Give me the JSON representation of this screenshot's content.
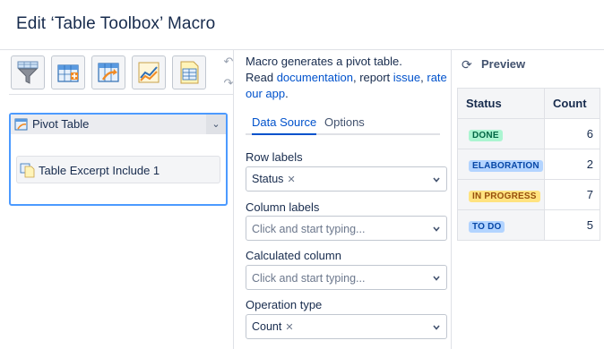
{
  "header": {
    "title": "Edit ‘Table Toolbox’ Macro"
  },
  "toolbar": {
    "buttons": [
      {
        "icon": "funnel-icon"
      },
      {
        "icon": "add-table-icon"
      },
      {
        "icon": "transform-table-icon"
      },
      {
        "icon": "chart-icon"
      },
      {
        "icon": "table-excerpt-icon"
      }
    ],
    "undo_icon": "↶",
    "redo_icon": "↷"
  },
  "tree": {
    "root_label": "Pivot Table",
    "child_label": "Table Excerpt Include 1",
    "chevron": "⌄"
  },
  "description": {
    "line1": "Macro generates a pivot table.",
    "read": "Read ",
    "doc_link": "documentation",
    "report": ", report ",
    "issue_link": "issue",
    "comma": ", ",
    "rate_link": "rate our app",
    "period": "."
  },
  "tabs": {
    "data_source": "Data Source",
    "options": "Options"
  },
  "fields": {
    "row_labels": {
      "label": "Row labels",
      "value": "Status",
      "remove": "✕"
    },
    "column_labels": {
      "label": "Column labels",
      "placeholder": "Click and start typing..."
    },
    "calculated_column": {
      "label": "Calculated column",
      "placeholder": "Click and start typing..."
    },
    "operation_type": {
      "label": "Operation type",
      "value": "Count",
      "remove": "✕"
    }
  },
  "preview": {
    "title": "Preview",
    "refresh_icon": "⟳",
    "headers": [
      "Status",
      "Count"
    ],
    "rows": [
      {
        "status": "DONE",
        "count": "6",
        "bg": "#abf5d1",
        "fg": "#006644"
      },
      {
        "status": "ELABORATION",
        "count": "2",
        "bg": "#b3d4ff",
        "fg": "#0747a6"
      },
      {
        "status": "IN PROGRESS",
        "count": "7",
        "bg": "#ffe380",
        "fg": "#974f0c"
      },
      {
        "status": "TO DO",
        "count": "5",
        "bg": "#b3d4ff",
        "fg": "#0747a6"
      }
    ]
  }
}
